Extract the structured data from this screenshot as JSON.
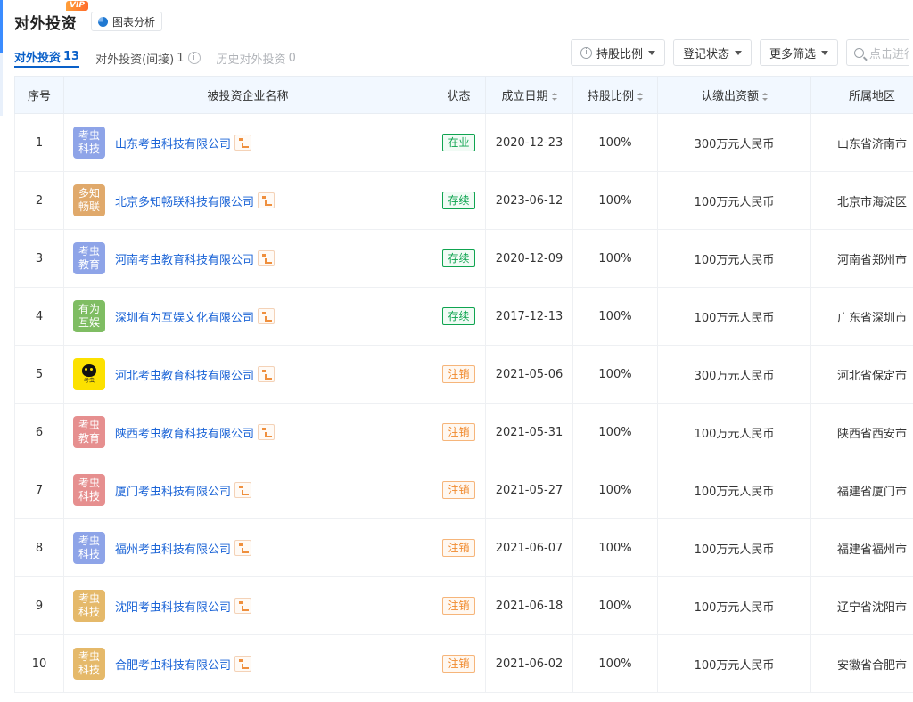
{
  "header": {
    "title": "对外投资",
    "vip": "VIP",
    "chart_label": "图表分析"
  },
  "tabs": [
    {
      "label": "对外投资",
      "count": "13"
    },
    {
      "label": "对外投资(间接)",
      "count": "1"
    },
    {
      "label": "历史对外投资",
      "count": "0"
    }
  ],
  "filters": {
    "share": "持股比例",
    "status": "登记状态",
    "more": "更多筛选",
    "search_placeholder": "点击进行搜索"
  },
  "columns": {
    "seq": "序号",
    "company": "被投资企业名称",
    "status": "状态",
    "date": "成立日期",
    "share": "持股比例",
    "capital": "认缴出资额",
    "region": "所属地区"
  },
  "colors": {
    "accent": "#0a60c8",
    "link": "#1a63d6",
    "active_status": "#0fa450",
    "cancelled_status": "#f08a2e"
  },
  "rows": [
    {
      "seq": "1",
      "logo": [
        "考虫",
        "科技"
      ],
      "logo_color": "#8ea4e8",
      "name": "山东考虫科技有限公司",
      "status": "在业",
      "status_type": "green",
      "date": "2020-12-23",
      "share": "100%",
      "capital": "300万元人民币",
      "region": "山东省济南市"
    },
    {
      "seq": "2",
      "logo": [
        "多知",
        "畅联"
      ],
      "logo_color": "#e0a96b",
      "name": "北京多知畅联科技有限公司",
      "status": "存续",
      "status_type": "green",
      "date": "2023-06-12",
      "share": "100%",
      "capital": "100万元人民币",
      "region": "北京市海淀区"
    },
    {
      "seq": "3",
      "logo": [
        "考虫",
        "教育"
      ],
      "logo_color": "#8ea4e8",
      "name": "河南考虫教育科技有限公司",
      "status": "存续",
      "status_type": "green",
      "date": "2020-12-09",
      "share": "100%",
      "capital": "100万元人民币",
      "region": "河南省郑州市"
    },
    {
      "seq": "4",
      "logo": [
        "有为",
        "互娱"
      ],
      "logo_color": "#7fbd63",
      "name": "深圳有为互娱文化有限公司",
      "status": "存续",
      "status_type": "green",
      "date": "2017-12-13",
      "share": "100%",
      "capital": "100万元人民币",
      "region": "广东省深圳市"
    },
    {
      "seq": "5",
      "logo": [
        "考虫"
      ],
      "logo_color": "#fce100",
      "logo_kind": "yellow",
      "name": "河北考虫教育科技有限公司",
      "status": "注销",
      "status_type": "orange",
      "date": "2021-05-06",
      "share": "100%",
      "capital": "300万元人民币",
      "region": "河北省保定市"
    },
    {
      "seq": "6",
      "logo": [
        "考虫",
        "教育"
      ],
      "logo_color": "#e68f8f",
      "name": "陕西考虫教育科技有限公司",
      "status": "注销",
      "status_type": "orange",
      "date": "2021-05-31",
      "share": "100%",
      "capital": "100万元人民币",
      "region": "陕西省西安市"
    },
    {
      "seq": "7",
      "logo": [
        "考虫",
        "科技"
      ],
      "logo_color": "#e68f8f",
      "name": "厦门考虫科技有限公司",
      "status": "注销",
      "status_type": "orange",
      "date": "2021-05-27",
      "share": "100%",
      "capital": "100万元人民币",
      "region": "福建省厦门市"
    },
    {
      "seq": "8",
      "logo": [
        "考虫",
        "科技"
      ],
      "logo_color": "#8ea4e8",
      "name": "福州考虫科技有限公司",
      "status": "注销",
      "status_type": "orange",
      "date": "2021-06-07",
      "share": "100%",
      "capital": "100万元人民币",
      "region": "福建省福州市"
    },
    {
      "seq": "9",
      "logo": [
        "考虫",
        "科技"
      ],
      "logo_color": "#e5b96a",
      "name": "沈阳考虫科技有限公司",
      "status": "注销",
      "status_type": "orange",
      "date": "2021-06-18",
      "share": "100%",
      "capital": "100万元人民币",
      "region": "辽宁省沈阳市"
    },
    {
      "seq": "10",
      "logo": [
        "考虫",
        "科技"
      ],
      "logo_color": "#e5b96a",
      "name": "合肥考虫科技有限公司",
      "status": "注销",
      "status_type": "orange",
      "date": "2021-06-02",
      "share": "100%",
      "capital": "100万元人民币",
      "region": "安徽省合肥市"
    }
  ]
}
